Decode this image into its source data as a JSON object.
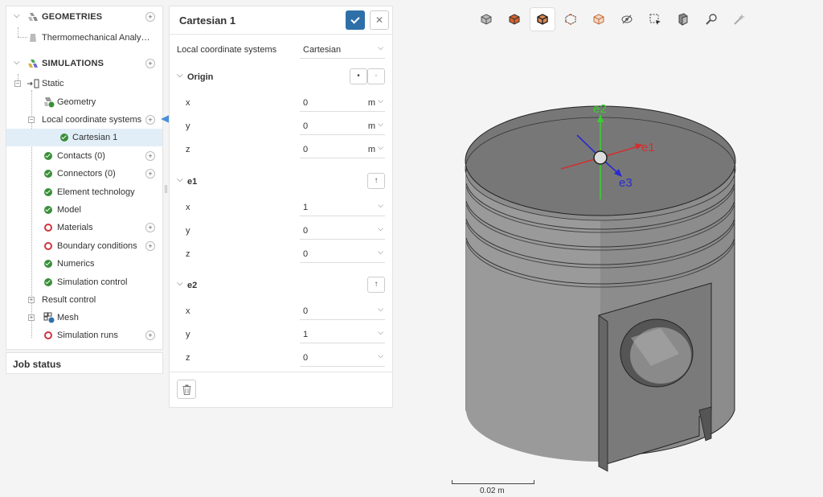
{
  "tree": {
    "geometries_label": "GEOMETRIES",
    "geometry_item": "Thermomechanical Analysis ...",
    "simulations_label": "SIMULATIONS",
    "static_label": "Static",
    "geometry_label": "Geometry",
    "lcs_label": "Local coordinate systems",
    "cartesian_label": "Cartesian 1",
    "contacts_label": "Contacts (0)",
    "connectors_label": "Connectors (0)",
    "element_tech_label": "Element technology",
    "model_label": "Model",
    "materials_label": "Materials",
    "bc_label": "Boundary conditions",
    "numerics_label": "Numerics",
    "sim_control_label": "Simulation control",
    "result_control_label": "Result control",
    "mesh_label": "Mesh",
    "sim_runs_label": "Simulation runs",
    "plus": "+",
    "minus": "−",
    "chevron": "⌵"
  },
  "job_status": "Job status",
  "props": {
    "title": "Cartesian 1",
    "close": "✕",
    "lcs_label": "Local coordinate systems",
    "lcs_value": "Cartesian",
    "origin_label": "Origin",
    "e1_label": "e1",
    "e2_label": "e2",
    "origin": {
      "x": "0",
      "y": "0",
      "z": "0"
    },
    "e1": {
      "x": "1",
      "y": "0",
      "z": "0"
    },
    "e2": {
      "x": "0",
      "y": "1",
      "z": "0"
    },
    "axis_x": "x",
    "axis_y": "y",
    "axis_z": "z",
    "unit": "m",
    "caret": "⌵",
    "pick_icon": "•",
    "align_icon": "↑"
  },
  "viewport": {
    "axis_e1": "e1",
    "axis_e2": "e2",
    "axis_e3": "e3",
    "scale_label": "0.02 m"
  },
  "colors": {
    "accent": "#2f6fa8",
    "ok": "#3a8f3a",
    "error": "#d0353f",
    "arrow": "#4a8fdc",
    "e1": "#d03030",
    "e2": "#3acf30",
    "e3": "#2a2ad0"
  }
}
